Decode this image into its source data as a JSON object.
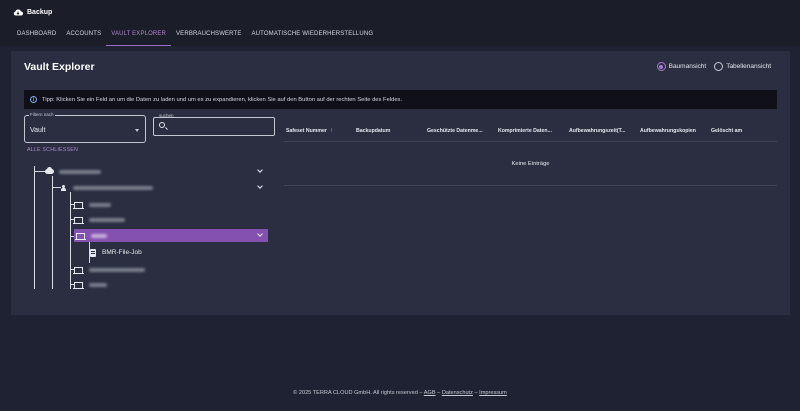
{
  "app": {
    "title": "Backup",
    "logo_icon": "cloud-icon"
  },
  "nav": {
    "items": [
      {
        "label": "DASHBOARD",
        "active": false
      },
      {
        "label": "ACCOUNTS",
        "active": false
      },
      {
        "label": "VAULT EXPLORER",
        "active": true
      },
      {
        "label": "VERBRAUCHSWERTE",
        "active": false
      },
      {
        "label": "AUTOMATISCHE WIEDERHERSTELLUNG",
        "active": false
      }
    ]
  },
  "page": {
    "title": "Vault Explorer",
    "view_options": {
      "tree": "Baumansicht",
      "table": "Tabellenansicht",
      "selected": "tree"
    },
    "tip": "Tipp: Klicken Sie ein Feld an um die Daten zu laden und um es zu expandieren, klicken Sie auf den Button auf der rechten Seite des Feldes."
  },
  "filter": {
    "label": "Filtern nach",
    "value": "Vault"
  },
  "search": {
    "label": "suchen",
    "placeholder": ""
  },
  "tree": {
    "collapse_all": "ALLE SCHLIESSEN",
    "job_label": "BMR-File-Job"
  },
  "table": {
    "columns": [
      "Safeset Nummer",
      "Backupdatum",
      "Geschützte Datenme...",
      "Komprimierte Daten...",
      "Aufbewahrungszeit(T...",
      "Aufbewahrungskopien",
      "Gelöscht am"
    ],
    "empty_text": "Keine Einträge"
  },
  "footer": {
    "copyright": "© 2025 TERRA CLOUD GmbH. All rights reserved –",
    "agb": "AGB",
    "sep1": "–",
    "privacy": "Datenschutz",
    "sep2": "–",
    "imprint": "Impressum"
  },
  "colors": {
    "accent": "#9a6fc0",
    "selected_row": "#8551b0",
    "background": "#1f2232",
    "card": "#2a2e40"
  }
}
